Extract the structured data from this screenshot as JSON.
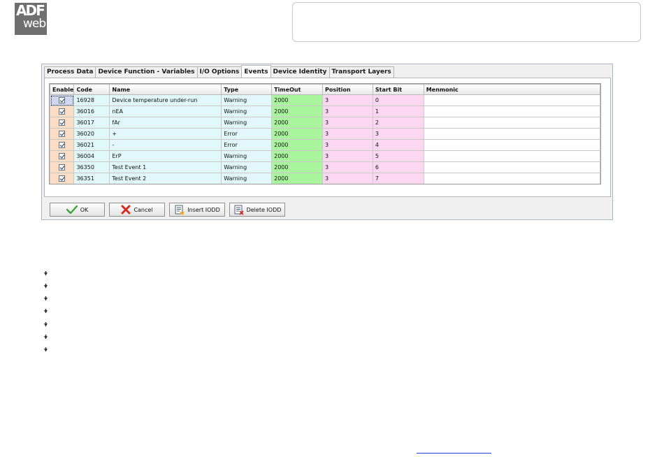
{
  "logo": {
    "line1": "ADF",
    "line2": "web"
  },
  "tabs": [
    {
      "label": "Process Data",
      "active": false
    },
    {
      "label": "Device Function - Variables",
      "active": false
    },
    {
      "label": "I/O Options",
      "active": false
    },
    {
      "label": "Events",
      "active": true
    },
    {
      "label": "Device Identity",
      "active": false
    },
    {
      "label": "Transport Layers",
      "active": false
    }
  ],
  "table": {
    "headers": {
      "enable": "Enable",
      "code": "Code",
      "name": "Name",
      "type": "Type",
      "timeout": "TimeOut",
      "position": "Position",
      "startbit": "Start Bit",
      "mnemonic": "Menmonic"
    },
    "rows": [
      {
        "enable": true,
        "code": "16928",
        "name": "Device temperature under-run",
        "type": "Warning",
        "timeout": "2000",
        "position": "3",
        "startbit": "0",
        "mnemonic": ""
      },
      {
        "enable": true,
        "code": "36016",
        "name": "nEA",
        "type": "Warning",
        "timeout": "2000",
        "position": "3",
        "startbit": "1",
        "mnemonic": ""
      },
      {
        "enable": true,
        "code": "36017",
        "name": "fAr",
        "type": "Warning",
        "timeout": "2000",
        "position": "3",
        "startbit": "2",
        "mnemonic": ""
      },
      {
        "enable": true,
        "code": "36020",
        "name": "+",
        "type": "Error",
        "timeout": "2000",
        "position": "3",
        "startbit": "3",
        "mnemonic": ""
      },
      {
        "enable": true,
        "code": "36021",
        "name": "-",
        "type": "Error",
        "timeout": "2000",
        "position": "3",
        "startbit": "4",
        "mnemonic": ""
      },
      {
        "enable": true,
        "code": "36004",
        "name": "ErP",
        "type": "Warning",
        "timeout": "2000",
        "position": "3",
        "startbit": "5",
        "mnemonic": ""
      },
      {
        "enable": true,
        "code": "36350",
        "name": "Test Event 1",
        "type": "Warning",
        "timeout": "2000",
        "position": "3",
        "startbit": "6",
        "mnemonic": ""
      },
      {
        "enable": true,
        "code": "36351",
        "name": "Test Event 2",
        "type": "Warning",
        "timeout": "2000",
        "position": "3",
        "startbit": "7",
        "mnemonic": ""
      }
    ]
  },
  "buttons": {
    "ok": {
      "label": "OK",
      "icon": "check-icon"
    },
    "cancel": {
      "label": "Cancel",
      "icon": "red-x-icon"
    },
    "insert": {
      "label": "Insert IODD",
      "icon": "insert-document-icon"
    },
    "delete": {
      "label": "Delete IODD",
      "icon": "delete-document-icon"
    }
  },
  "colors": {
    "enable_col": "#fbdcc4",
    "info_cols": "#e1f7fa",
    "timeout_col": "#a9f59d",
    "position_cols": "#fbd7f2",
    "link": "#1f3fd1"
  }
}
